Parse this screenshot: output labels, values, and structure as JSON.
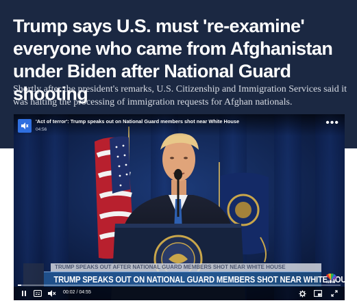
{
  "article": {
    "headline": "Trump says U.S. must 're-examine' everyone who came from Afghanistan under Biden after National Guard shooting",
    "dek": "Shortly after the president's remarks, U.S. Citizenship and Immigration Services said it was halting the processing of immigration requests for Afghan nationals."
  },
  "player": {
    "title": "'Act of terror': Trump speaks out on National Guard members shot near White House",
    "duration": "04:56",
    "more_icon": "more-options-icon",
    "mute_icon": "speaker-icon",
    "lower_third": {
      "upper_text": "TRUMP SPEAKS OUT AFTER NATIONAL GUARD MEMBERS SHOT NEAR WHITE HOUSE",
      "main_text": "TRUMP SPEAKS OUT ON NATIONAL GUARD MEMBERS SHOT NEAR WHITE HOUSE",
      "logo_text": "NOW"
    },
    "controls": {
      "current_time": "00:02",
      "separator": "/",
      "total_time": "04:55",
      "progress_fraction": 0.01
    }
  },
  "colors": {
    "header_background": "#1b2842",
    "accent_blue": "#2f6fe0"
  }
}
